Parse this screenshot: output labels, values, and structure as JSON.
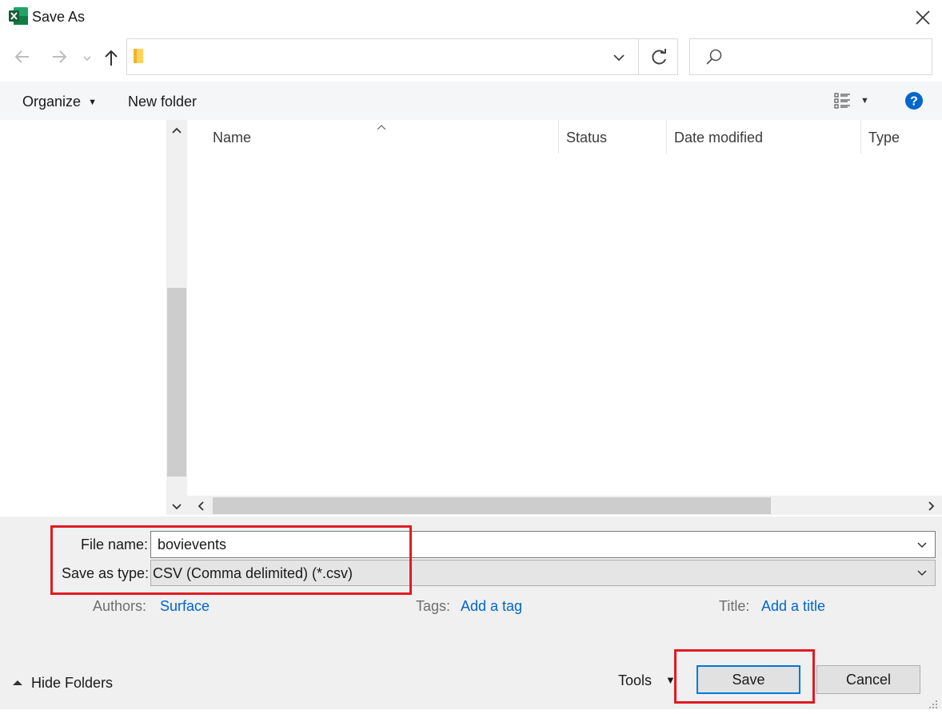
{
  "window": {
    "title": "Save As"
  },
  "search": {
    "placeholder": ""
  },
  "toolbar": {
    "organize": "Organize",
    "new_folder": "New folder"
  },
  "columns": [
    "Name",
    "Status",
    "Date modified",
    "Type"
  ],
  "form": {
    "file_name_label": "File name:",
    "file_name_value": "bovievents",
    "save_type_label": "Save as type:",
    "save_type_value": "CSV (Comma delimited) (*.csv)"
  },
  "meta": {
    "authors_label": "Authors:",
    "authors_value": "Surface",
    "tags_label": "Tags:",
    "tags_value": "Add a tag",
    "title_label": "Title:",
    "title_value": "Add a title"
  },
  "footer": {
    "hide_folders": "Hide Folders",
    "tools": "Tools",
    "save": "Save",
    "cancel": "Cancel"
  },
  "colors": {
    "accent": "#0078d7",
    "highlight": "#e11b22",
    "excel_green": "#107c41"
  },
  "icons": [
    "excel-icon",
    "close-icon",
    "back-arrow-icon",
    "forward-arrow-icon",
    "chevron-down-icon",
    "up-arrow-icon",
    "folder-icon",
    "refresh-icon",
    "search-icon",
    "view-list-icon",
    "help-icon"
  ]
}
